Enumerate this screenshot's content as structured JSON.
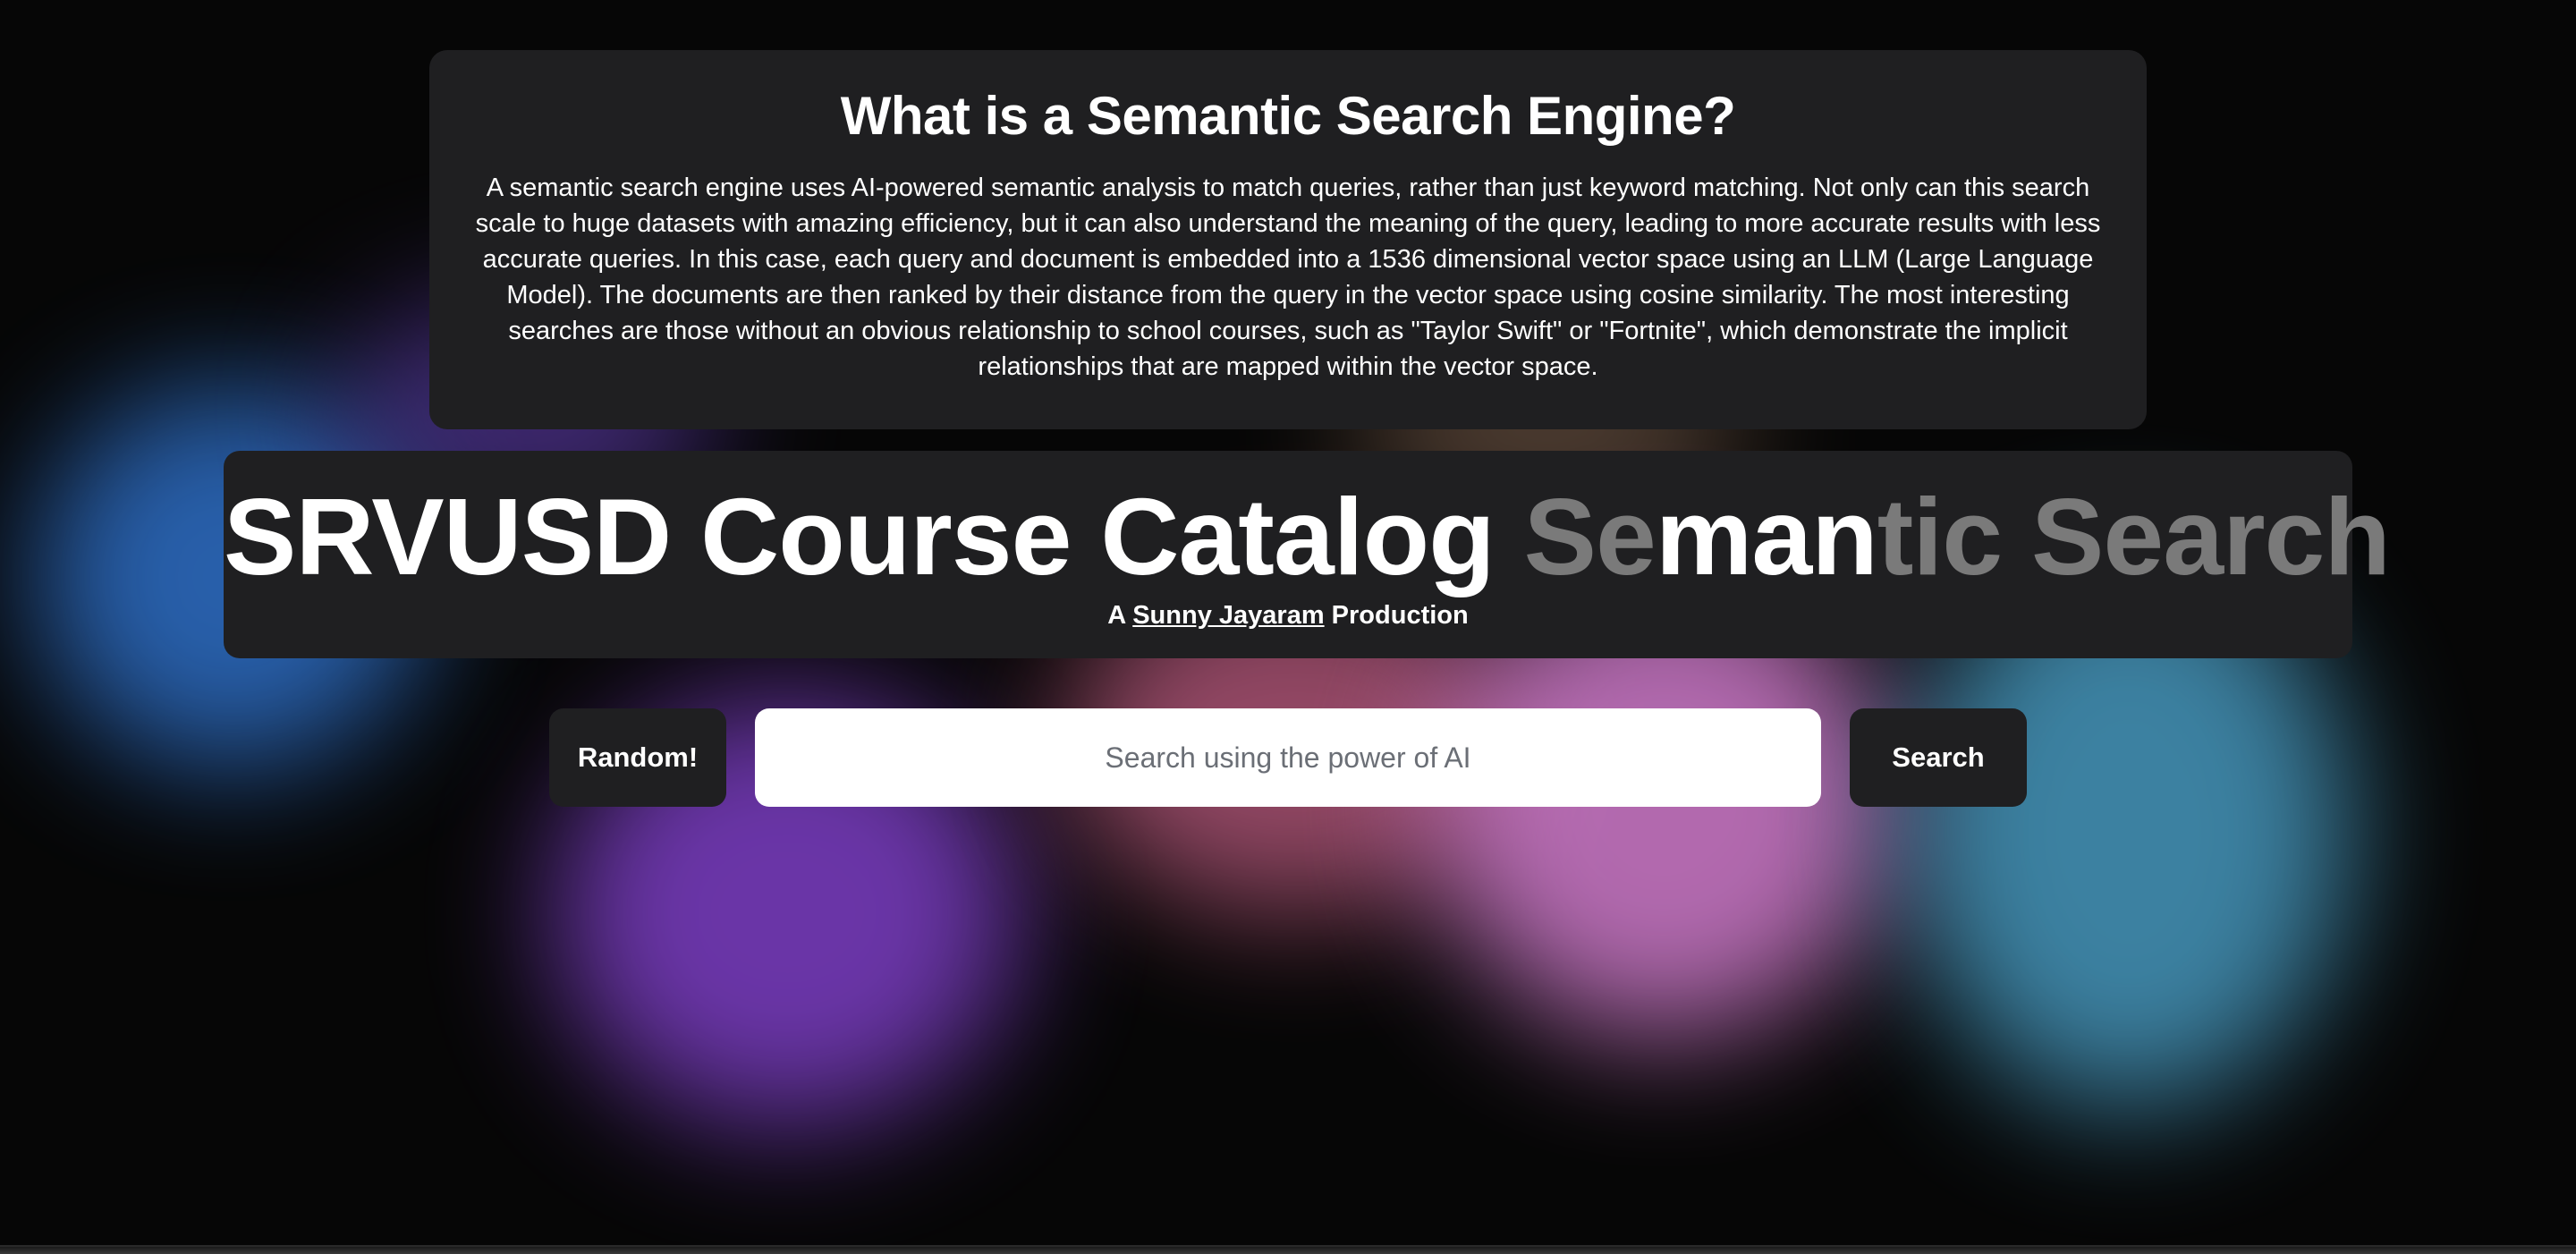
{
  "info": {
    "title": "What is a Semantic Search Engine?",
    "body": "A semantic search engine uses AI-powered semantic analysis to match queries, rather than just keyword matching. Not only can this search scale to huge datasets with amazing efficiency, but it can also understand the meaning of the query, leading to more accurate results with less accurate queries. In this case, each query and document is embedded into a 1536 dimensional vector space using an LLM (Large Language Model). The documents are then ranked by their distance from the query in the vector space using cosine similarity. The most interesting searches are those without an obvious relationship to school courses, such as \"Taylor Swift\" or \"Fortnite\", which demonstrate the implicit relationships that are mapped within the vector space."
  },
  "header": {
    "title_main": "SRVUSD Course Catalog",
    "title_part1": "Se",
    "title_part2": "man",
    "title_part3": "tic Search",
    "subtitle_prefix": "A",
    "author": "Sunny Jayaram",
    "subtitle_suffix": "Production"
  },
  "search": {
    "random_label": "Random!",
    "placeholder": "Search using the power of AI",
    "value": "",
    "search_label": "Search"
  },
  "colors": {
    "card_bg": "#1f1f21",
    "dim_title": "#7a7a7a",
    "text": "#ffffff"
  }
}
